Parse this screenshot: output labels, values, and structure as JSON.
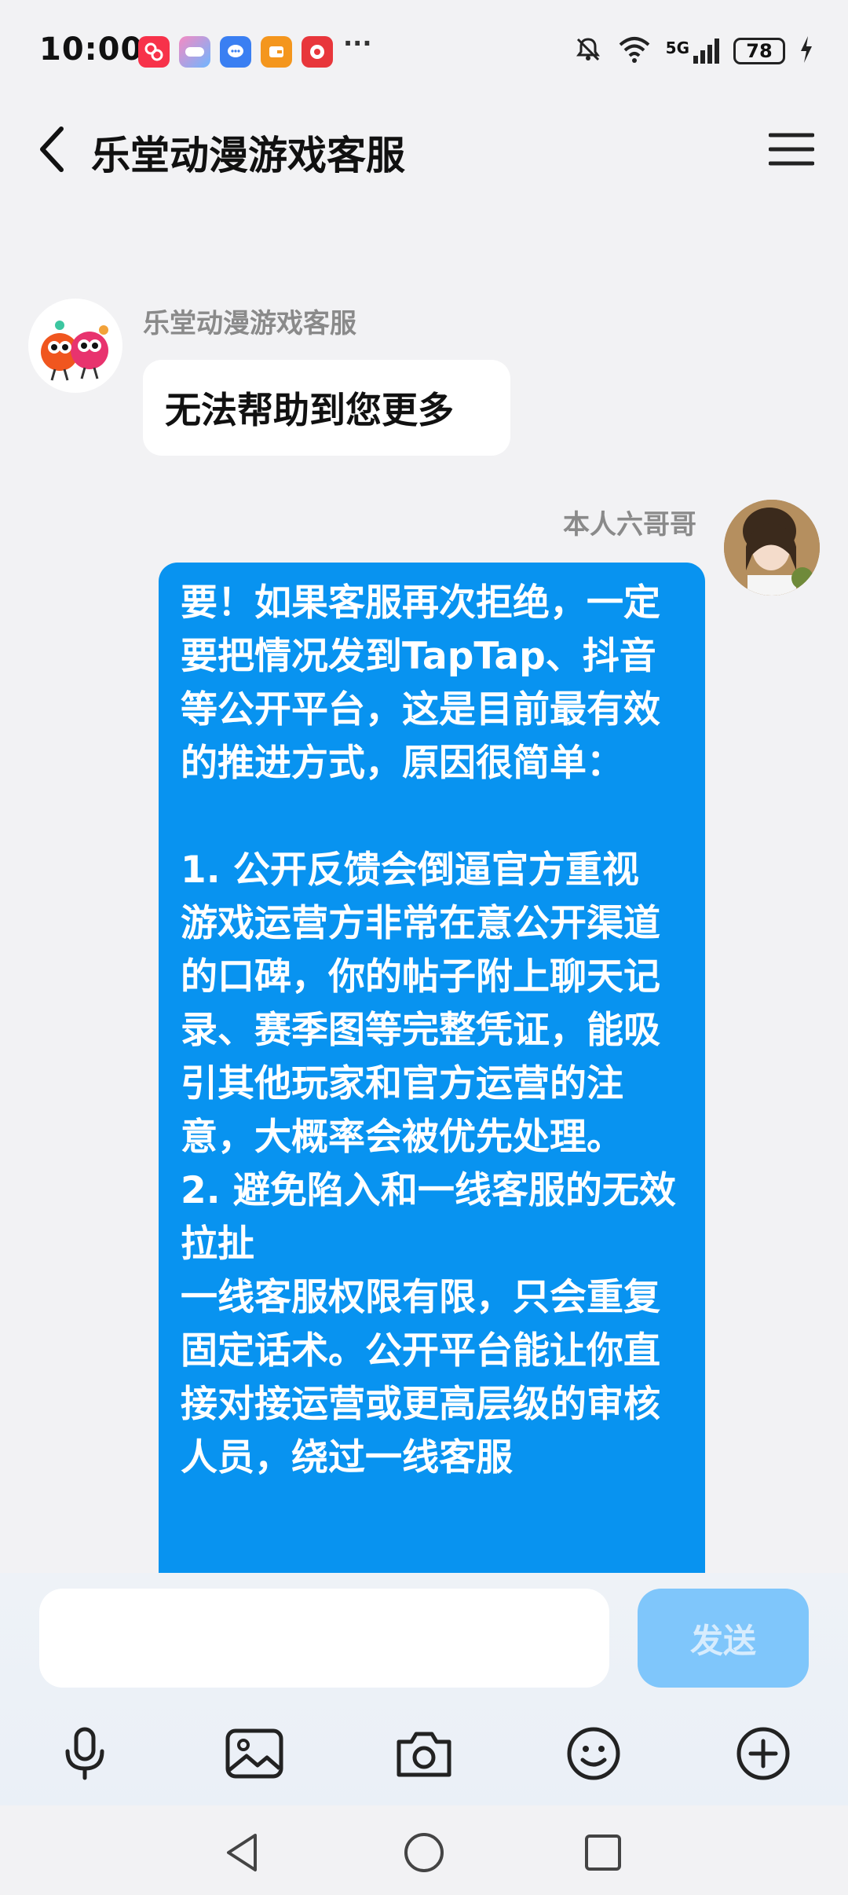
{
  "status_bar": {
    "time": "10:00",
    "more": "···",
    "battery": "78",
    "network": "5G",
    "app_icon_colors": [
      "#f7324a",
      "#7b8cf0",
      "#3a7ff2",
      "#f4961d",
      "#e8363b"
    ]
  },
  "header": {
    "title": "乐堂动漫游戏客服"
  },
  "messages": [
    {
      "side": "left",
      "sender": "乐堂动漫游戏客服",
      "text": "无法帮助到您更多"
    },
    {
      "side": "right",
      "sender": "本人六哥哥",
      "text": "要！如果客服再次拒绝，一定要把情况发到TapTap、抖音等公开平台，这是目前最有效的推进方式，原因很简单：\n\n1. 公开反馈会倒逼官方重视\n游戏运营方非常在意公开渠道的口碑，你的帖子附上聊天记录、赛季图等完整凭证，能吸引其他玩家和官方运营的注意，大概率会被优先处理。\n2. 避免陷入和一线客服的无效拉扯\n一线客服权限有限，只会重复固定话术。公开平台能让你直接对接运营或更高层级的审核人员，绕过一线客服"
    }
  ],
  "input": {
    "value": "",
    "placeholder": "",
    "send_label": "发送"
  },
  "colors": {
    "accent": "#0893f0",
    "send_disabled": "#7fc6fb",
    "background": "#f2f2f4"
  },
  "toolbar_icons": [
    "microphone-icon",
    "image-icon",
    "camera-icon",
    "emoji-icon",
    "plus-icon"
  ],
  "nav_icons": [
    "back-triangle-icon",
    "home-circle-icon",
    "recents-square-icon"
  ]
}
